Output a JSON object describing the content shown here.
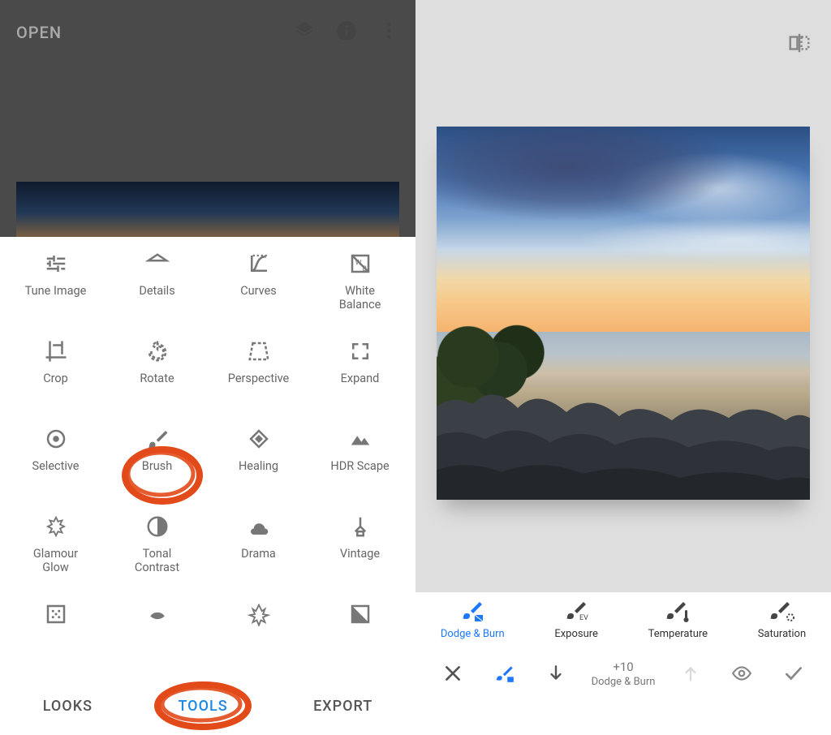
{
  "left": {
    "header": {
      "open_label": "OPEN"
    },
    "tools": [
      {
        "id": "tune-image",
        "label": "Tune Image"
      },
      {
        "id": "details",
        "label": "Details"
      },
      {
        "id": "curves",
        "label": "Curves"
      },
      {
        "id": "white-balance",
        "label": "White\nBalance"
      },
      {
        "id": "crop",
        "label": "Crop"
      },
      {
        "id": "rotate",
        "label": "Rotate"
      },
      {
        "id": "perspective",
        "label": "Perspective"
      },
      {
        "id": "expand",
        "label": "Expand"
      },
      {
        "id": "selective",
        "label": "Selective"
      },
      {
        "id": "brush",
        "label": "Brush"
      },
      {
        "id": "healing",
        "label": "Healing"
      },
      {
        "id": "hdr-scape",
        "label": "HDR Scape"
      },
      {
        "id": "glamour-glow",
        "label": "Glamour\nGlow"
      },
      {
        "id": "tonal-contrast",
        "label": "Tonal\nContrast"
      },
      {
        "id": "drama",
        "label": "Drama"
      },
      {
        "id": "vintage",
        "label": "Vintage"
      },
      {
        "id": "grainy-film",
        "label": ""
      },
      {
        "id": "retrolux",
        "label": ""
      },
      {
        "id": "grunge",
        "label": ""
      },
      {
        "id": "bw",
        "label": ""
      }
    ],
    "tabs": {
      "looks": "LOOKS",
      "tools": "TOOLS",
      "export": "EXPORT",
      "active": "tools"
    }
  },
  "right": {
    "brushTabs": [
      {
        "id": "dodge-burn",
        "label": "Dodge & Burn",
        "active": true
      },
      {
        "id": "exposure",
        "label": "Exposure",
        "active": false
      },
      {
        "id": "temperature",
        "label": "Temperature",
        "active": false
      },
      {
        "id": "saturation",
        "label": "Saturation",
        "active": false
      }
    ],
    "control": {
      "value": "+10",
      "name": "Dodge & Burn"
    }
  },
  "colors": {
    "accent": "#1e78ff",
    "annotation": "#e24a1a"
  }
}
